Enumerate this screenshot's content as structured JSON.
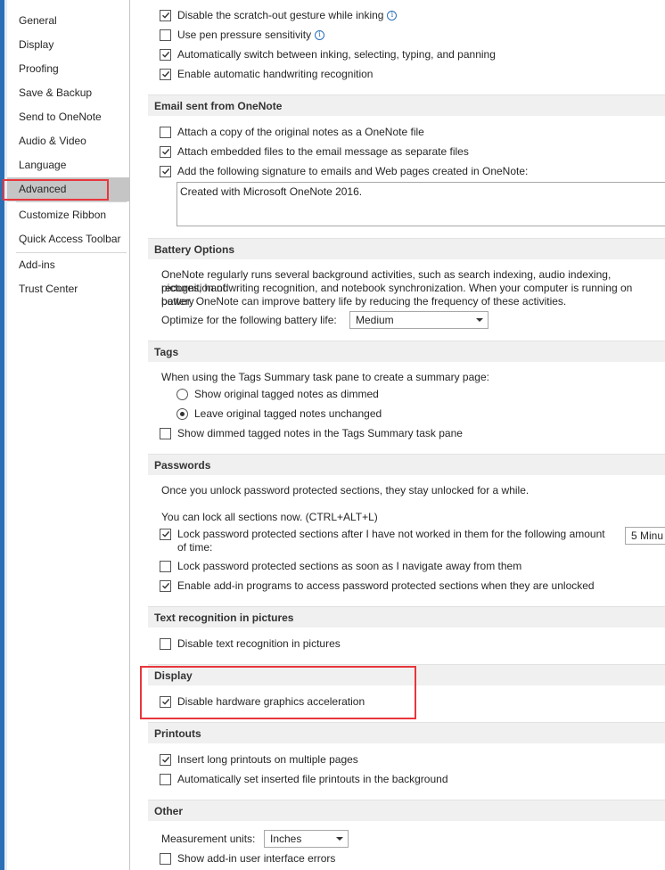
{
  "nav": {
    "items": [
      {
        "label": "General"
      },
      {
        "label": "Display"
      },
      {
        "label": "Proofing"
      },
      {
        "label": "Save & Backup"
      },
      {
        "label": "Send to OneNote"
      },
      {
        "label": "Audio & Video"
      },
      {
        "label": "Language"
      },
      {
        "label": "Advanced"
      },
      {
        "label": "Customize Ribbon"
      },
      {
        "label": "Quick Access Toolbar"
      },
      {
        "label": "Add-ins"
      },
      {
        "label": "Trust Center"
      }
    ],
    "selected": "Advanced"
  },
  "top": {
    "scratch_out": "Disable the scratch-out gesture while inking",
    "pen_pressure": "Use pen pressure sensitivity",
    "auto_switch": "Automatically switch between inking, selecting, typing, and panning",
    "handwriting": "Enable automatic handwriting recognition"
  },
  "email": {
    "header": "Email sent from OneNote",
    "attach_copy": "Attach a copy of the original notes as a OneNote file",
    "attach_embedded": "Attach embedded files to the email message as separate files",
    "add_signature": "Add the following signature to emails and Web pages created in OneNote:",
    "signature_value": "Created with Microsoft OneNote 2016."
  },
  "battery": {
    "header": "Battery Options",
    "desc1": "OneNote regularly runs several background activities, such as search indexing, audio indexing, recognition of",
    "desc2": "pictures, handwriting recognition, and notebook synchronization. When your computer is running on battery",
    "desc3": "power, OneNote can improve battery life by reducing the frequency of these activities.",
    "optimize_label": "Optimize for the following battery life:",
    "optimize_value": "Medium"
  },
  "tags": {
    "header": "Tags",
    "intro": "When using the Tags Summary task pane to create a summary page:",
    "show_dimmed": "Show original tagged notes as dimmed",
    "leave_unchanged": "Leave original tagged notes unchanged",
    "show_dimmed_pane": "Show dimmed tagged notes in the Tags Summary task pane"
  },
  "passwords": {
    "header": "Passwords",
    "intro": "Once you unlock password protected sections, they stay unlocked for a while.",
    "lock_now": "You can lock all sections now. (CTRL+ALT+L)",
    "lock_after_1": "Lock password protected sections after I have not worked in them for the following amount",
    "lock_after_2": "of time:",
    "lock_after_value": "5 Minu",
    "lock_navigate": "Lock password protected sections as soon as I navigate away from them",
    "addin_access": "Enable add-in programs to access password protected sections when they are unlocked"
  },
  "text_recognition": {
    "header": "Text recognition in pictures",
    "disable": "Disable text recognition in pictures"
  },
  "display": {
    "header": "Display",
    "hw_accel": "Disable hardware graphics acceleration"
  },
  "printouts": {
    "header": "Printouts",
    "long_printouts": "Insert long printouts on multiple pages",
    "auto_background": "Automatically set inserted file printouts in the background"
  },
  "other": {
    "header": "Other",
    "units_label": "Measurement units:",
    "units_value": "Inches",
    "addin_errors": "Show add-in user interface errors"
  },
  "colors": {
    "accent_red": "#e8363c",
    "nav_selected": "#c5c5c5",
    "section_bg": "#f0f0f0"
  }
}
